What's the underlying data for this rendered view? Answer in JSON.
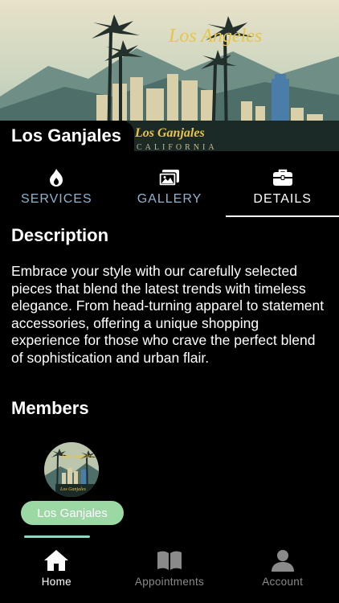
{
  "venue": {
    "name": "Los Ganjales",
    "banner": {
      "headline": "Los Angeles",
      "sign": "Los Ganjales",
      "subline": "CALIFORNIA"
    }
  },
  "tabs": [
    {
      "label": "SERVICES",
      "icon": "flame-icon",
      "active": false
    },
    {
      "label": "GALLERY",
      "icon": "image-icon",
      "active": false
    },
    {
      "label": "DETAILS",
      "icon": "briefcase-icon",
      "active": true
    }
  ],
  "details": {
    "description_heading": "Description",
    "description": "Embrace your style with our carefully selected pieces that blend the latest trends with timeless elegance. From head-turning apparel to statement accessories, offering a unique shopping experience for those who crave the perfect blend of sophistication and urban flair.",
    "members_heading": "Members",
    "members": [
      {
        "name": "Los Ganjales",
        "avatar_text": "Los Angeles",
        "avatar_sign": "Los Ganjales"
      }
    ]
  },
  "bottom_nav": [
    {
      "label": "Home",
      "icon": "home-icon",
      "active": true
    },
    {
      "label": "Appointments",
      "icon": "book-icon",
      "active": false
    },
    {
      "label": "Account",
      "icon": "person-icon",
      "active": false
    }
  ],
  "colors": {
    "background": "#000000",
    "tab_inactive": "#8fb3cf",
    "member_pill": "#9bd8a4",
    "nav_indicator": "#9ad0c6",
    "nav_inactive": "#8a8a8a"
  }
}
